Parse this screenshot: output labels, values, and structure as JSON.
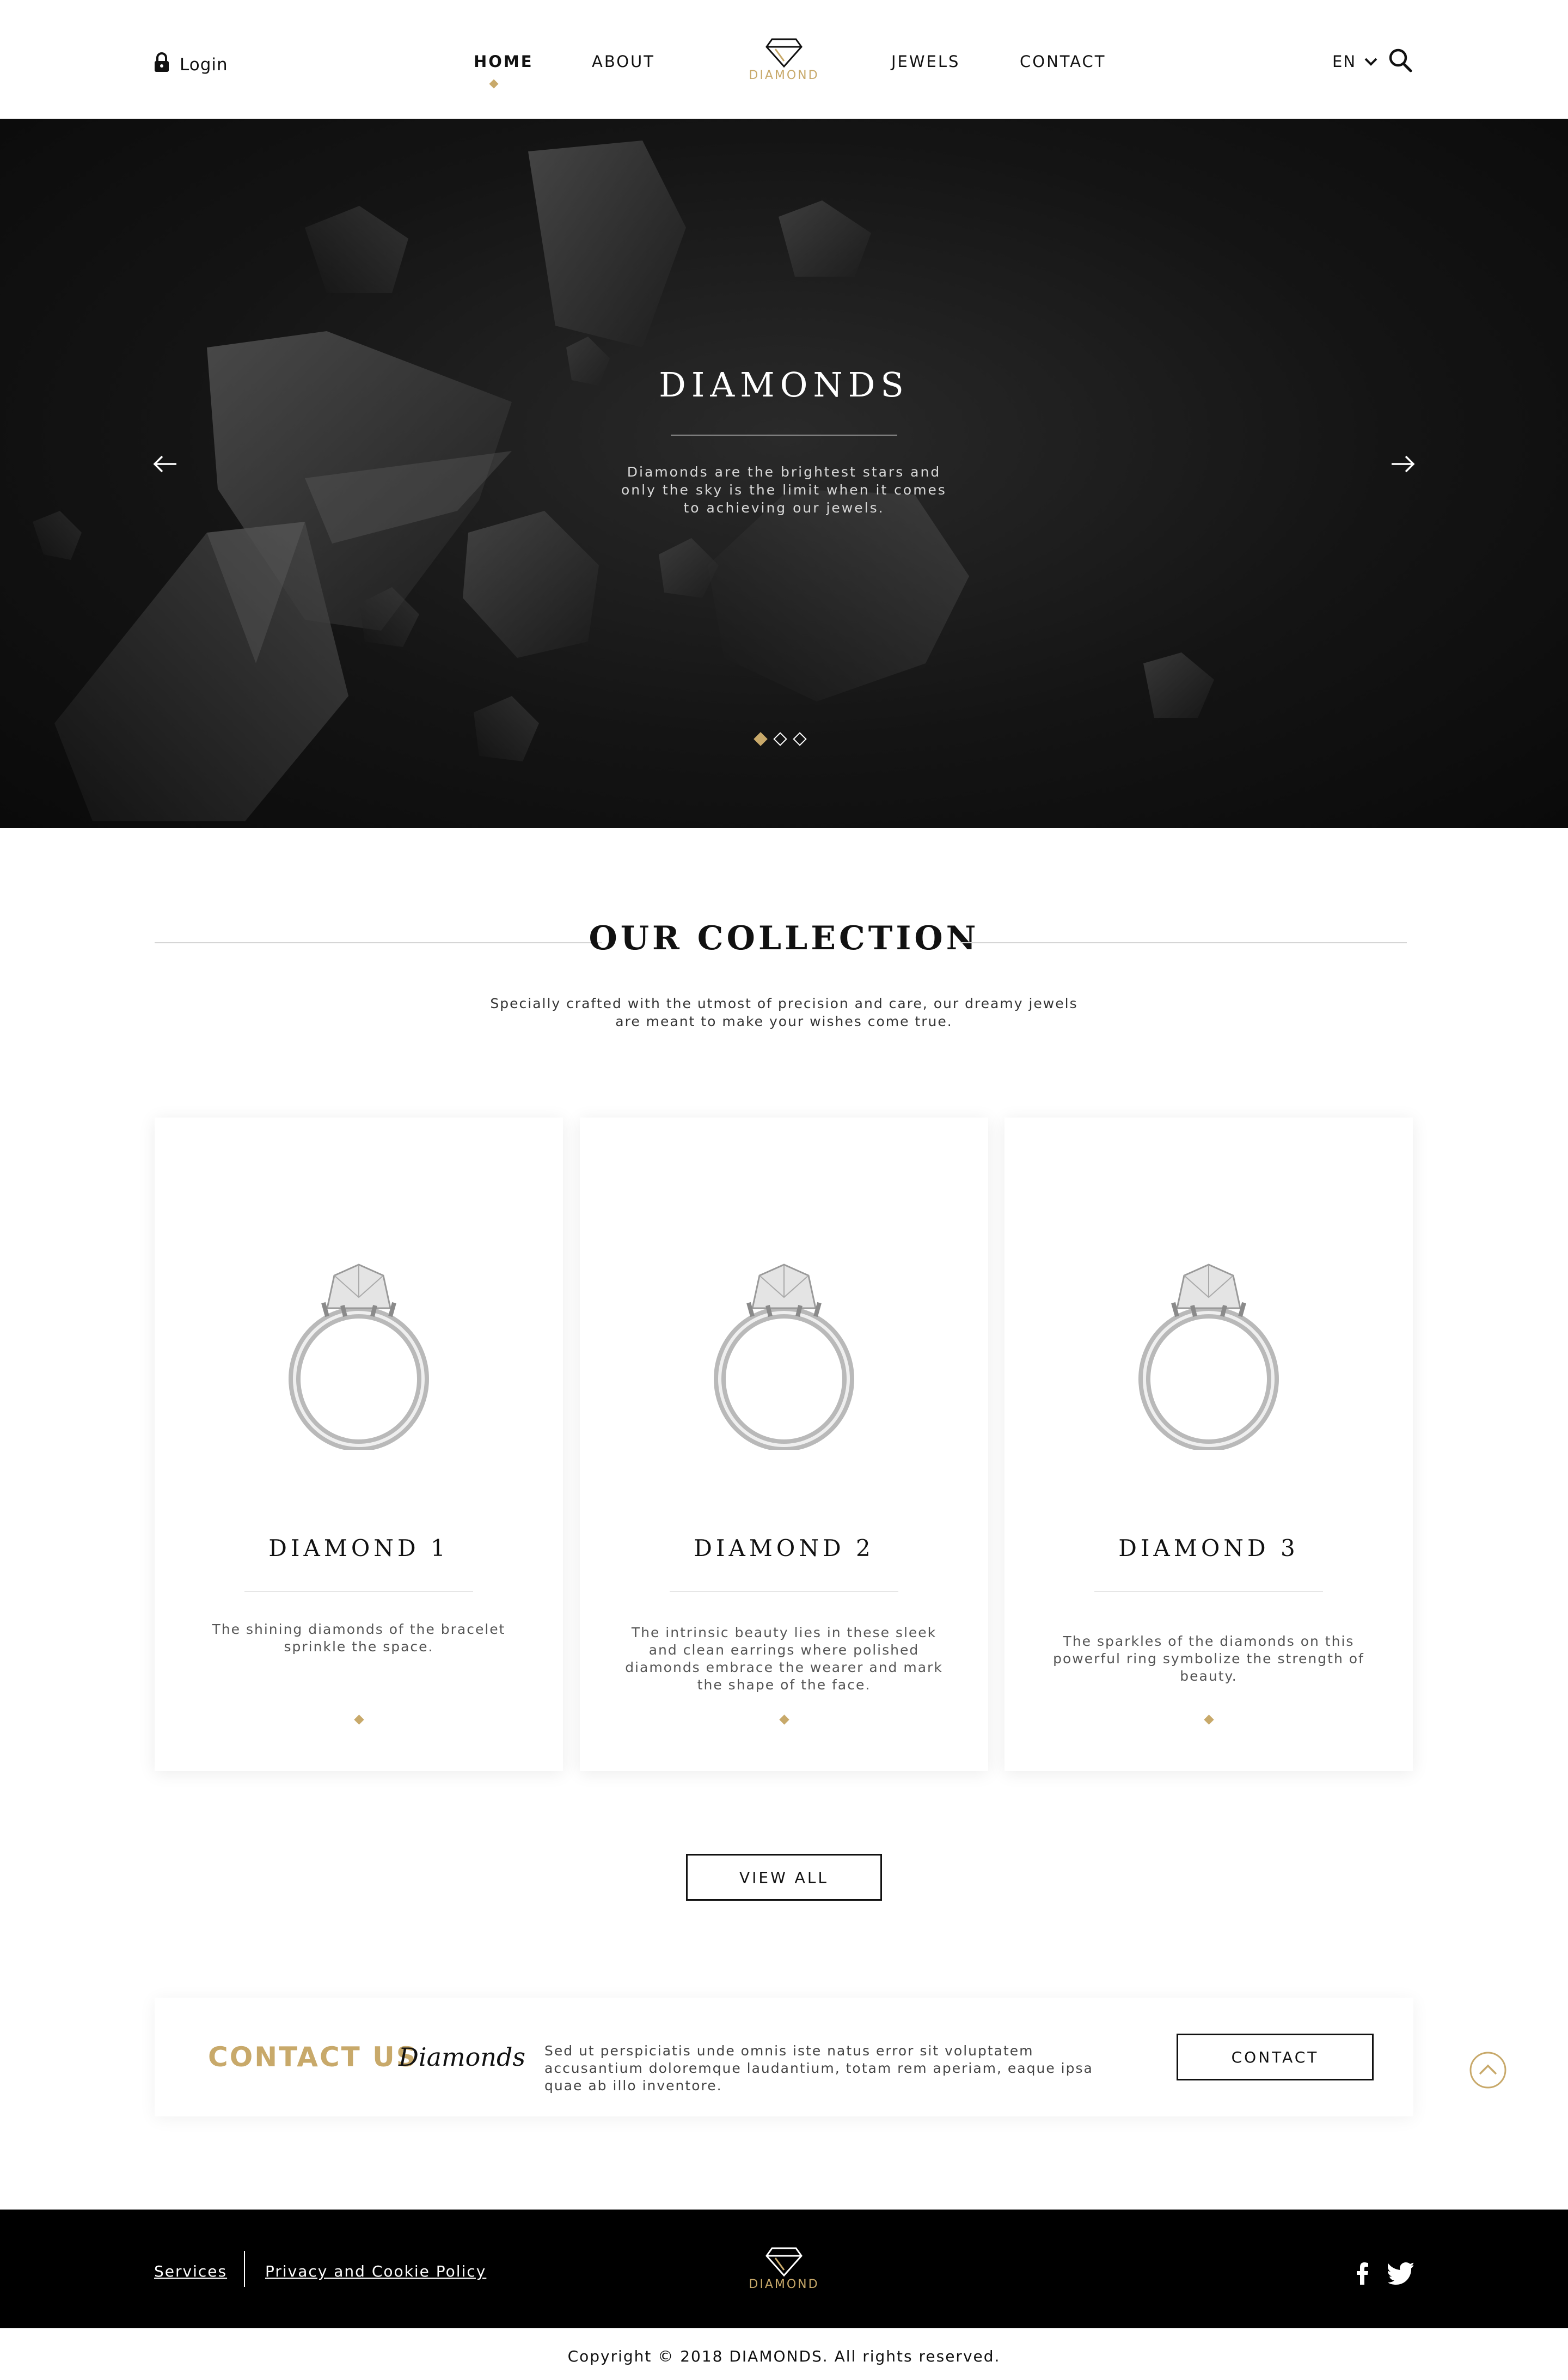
{
  "header": {
    "login_label": "Login",
    "nav": [
      "HOME",
      "ABOUT",
      "JEWELS",
      "CONTACT"
    ],
    "active_nav": "HOME",
    "logo_text": "DIAMOND",
    "language": "EN"
  },
  "hero": {
    "title": "DIAMONDS",
    "subtitle": "Diamonds are the brightest stars and only the sky is the limit when it comes to achieving our jewels.",
    "slide_count": 3,
    "active_slide": 1
  },
  "collection": {
    "title": "OUR COLLECTION",
    "subtitle": "Specially crafted with the utmost of precision and care, our dreamy jewels are meant to make your wishes come true.",
    "cards": [
      {
        "title": "DIAMOND 1",
        "text": "The shining diamonds of the bracelet sprinkle the space."
      },
      {
        "title": "DIAMOND 2",
        "text": "The intrinsic beauty lies in these sleek and clean earrings where polished diamonds embrace the wearer and mark the shape of the face."
      },
      {
        "title": "DIAMOND 3",
        "text": "The sparkles of the diamonds on this powerful ring symbolize the strength of beauty."
      }
    ],
    "view_all_label": "VIEW ALL"
  },
  "contact": {
    "title": "CONTACT US",
    "script_word": "Diamonds",
    "text": "Sed ut perspiciatis unde omnis iste natus error sit voluptatem accusantium doloremque laudantium, totam rem aperiam, eaque ipsa quae ab illo inventore.",
    "button_label": "CONTACT"
  },
  "footer": {
    "links": [
      "Services",
      "Privacy and Cookie Policy"
    ],
    "logo_text": "DIAMOND",
    "copyright": "Copyright © 2018 DIAMONDS. All rights reserved."
  },
  "colors": {
    "accent": "#c8a96a",
    "dark": "#111111",
    "footer_bg": "#000000"
  }
}
